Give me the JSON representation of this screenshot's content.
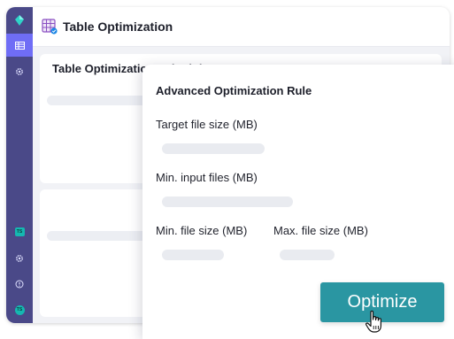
{
  "window": {
    "title": "Table Optimization"
  },
  "sidebar": {
    "items": [
      {
        "icon": "diamond-logo-icon"
      },
      {
        "icon": "table-icon",
        "active": true
      },
      {
        "icon": "gear-icon"
      },
      {
        "icon": "ts-badge-icon",
        "text": "TS"
      },
      {
        "icon": "gear-icon"
      },
      {
        "icon": "help-icon"
      },
      {
        "icon": "avatar-icon",
        "text": "TS"
      }
    ]
  },
  "main": {
    "card_title": "Table Optimization Schedules"
  },
  "popup": {
    "title": "Advanced Optimization Rule",
    "fields": {
      "target_file_size": "Target file size (MB)",
      "min_input_files": "Min. input files (MB)",
      "min_file_size": "Min. file size (MB)",
      "max_file_size": "Max. file size (MB)"
    }
  },
  "actions": {
    "optimize_label": "Optimize"
  },
  "colors": {
    "sidebar": "#4a4988",
    "sidebar_active": "#6f6df6",
    "accent": "#2a96a2",
    "badge": "#15b8b1"
  }
}
